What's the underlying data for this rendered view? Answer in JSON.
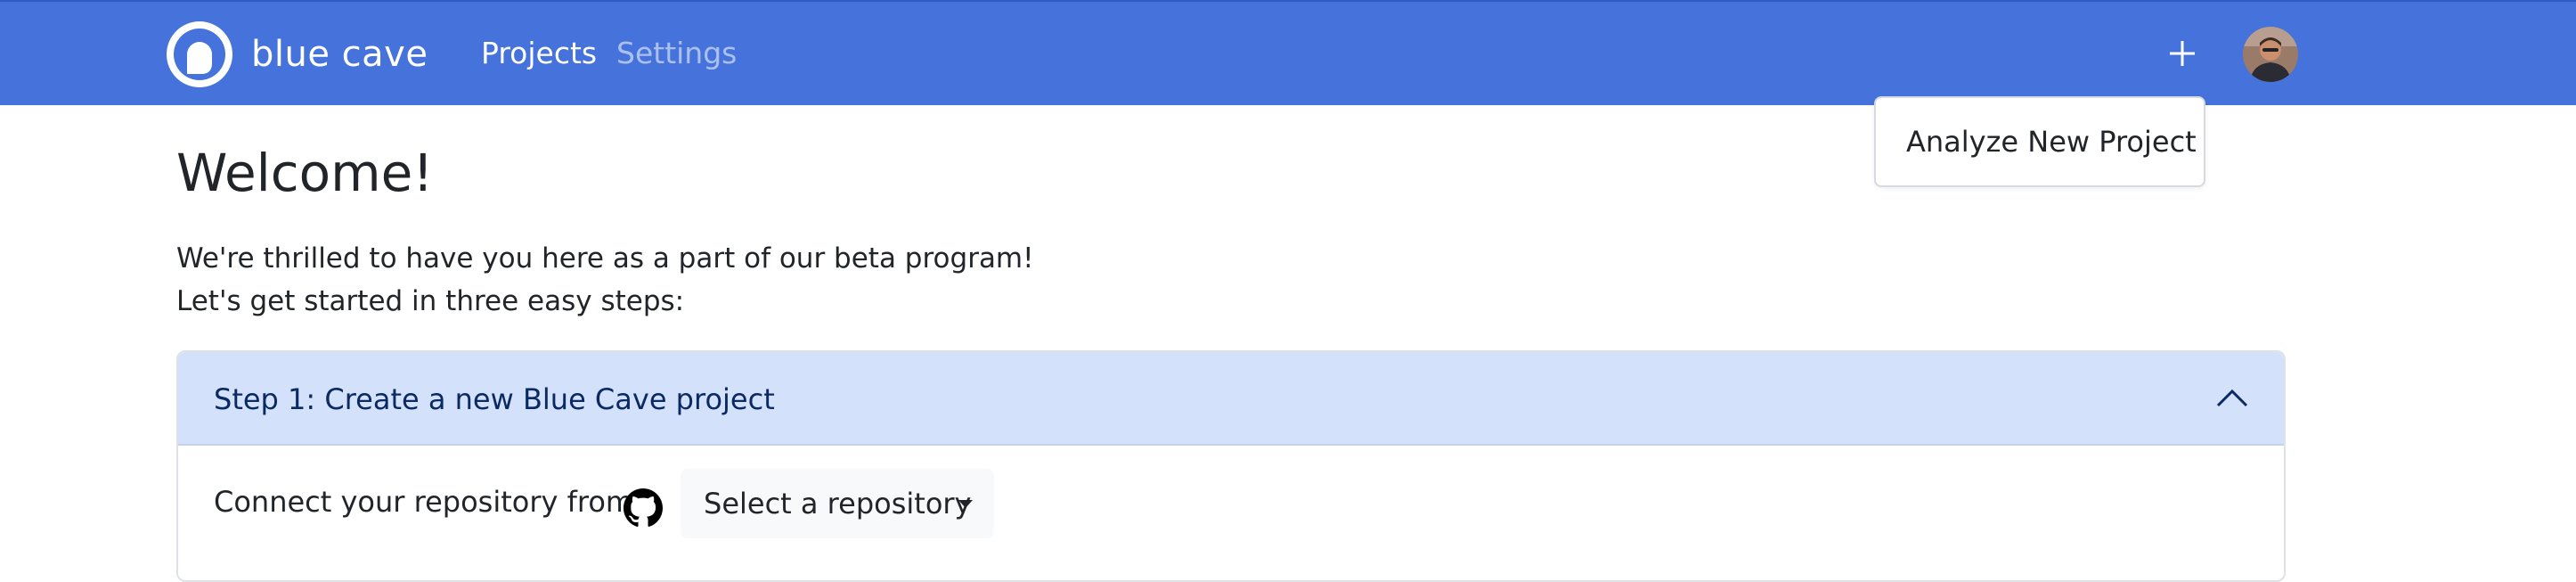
{
  "app": {
    "name": "blue cave"
  },
  "navbar": {
    "links": [
      {
        "label": "Projects",
        "active": true
      },
      {
        "label": "Settings",
        "active": false
      }
    ],
    "add_icon": "plus-icon",
    "avatar_icon": "user-avatar",
    "background": "#4573db"
  },
  "dropdown": {
    "items": [
      {
        "label": "Analyze New Project"
      }
    ]
  },
  "main": {
    "title": "Welcome!",
    "intro": [
      "We're thrilled to have you here as a part of our beta program!",
      "Let's get started in three easy steps:"
    ],
    "steps": [
      {
        "title": "Step 1: Create a new Blue Cave project",
        "expanded": true,
        "header_icon": "chevron-up-icon",
        "body": {
          "connect_label": "Connect your repository from",
          "provider_icon": "github-icon",
          "select_label": "Select a repository",
          "select_icon": "caret-down-icon"
        }
      }
    ]
  },
  "colors": {
    "accordion_header": "#d3e2fa",
    "accordion_title": "#0b2a63",
    "select_background": "#f8f9fa"
  }
}
